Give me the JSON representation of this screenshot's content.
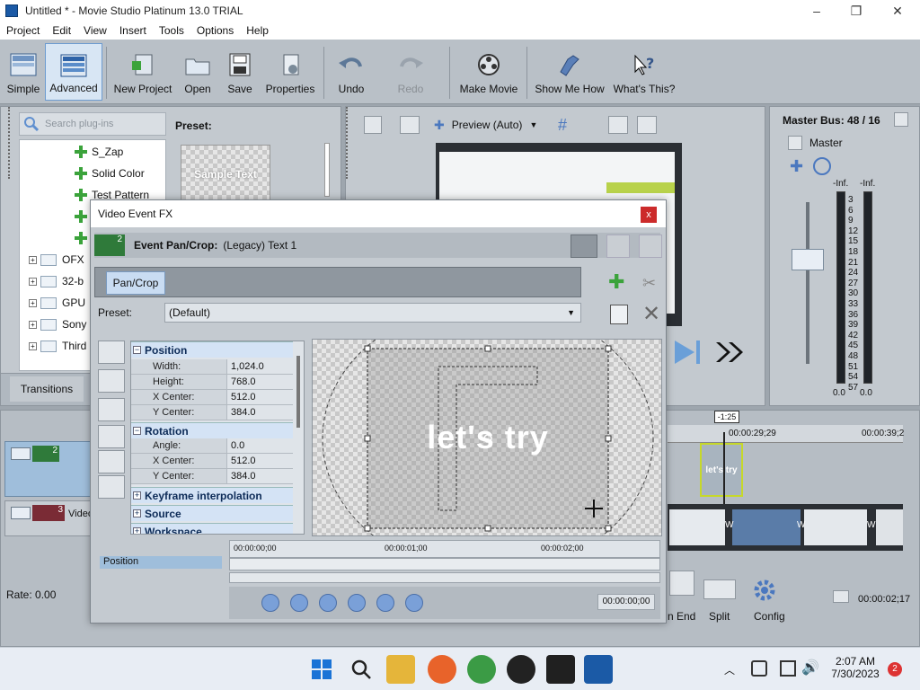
{
  "window": {
    "title": "Untitled * - Movie Studio Platinum 13.0 TRIAL",
    "minimize": "–",
    "maximize": "❐",
    "close": "✕"
  },
  "menu": [
    "Project",
    "Edit",
    "View",
    "Insert",
    "Tools",
    "Options",
    "Help"
  ],
  "toolbar": {
    "simple": "Simple",
    "advanced": "Advanced",
    "new_project": "New Project",
    "open": "Open",
    "save": "Save",
    "properties": "Properties",
    "undo": "Undo",
    "redo": "Redo",
    "make_movie": "Make Movie",
    "show_me_how": "Show Me How",
    "whats_this": "What's This?"
  },
  "plugins": {
    "search_placeholder": "Search plug-ins",
    "preset_label": "Preset:",
    "preset_thumb": "Sample Text",
    "items": [
      "S_Zap",
      "Solid Color",
      "Test Pattern"
    ],
    "folders": [
      "OFX",
      "32-b",
      "GPU",
      "Sony",
      "Third"
    ],
    "transitions_tab": "Transitions"
  },
  "preview": {
    "mode": "Preview (Auto)"
  },
  "master": {
    "label": "Master Bus: 48 / 16",
    "name": "Master",
    "left_inf": "-Inf.",
    "right_inf": "-Inf.",
    "scale": [
      "3",
      "6",
      "9",
      "12",
      "15",
      "18",
      "21",
      "24",
      "27",
      "30",
      "33",
      "36",
      "39",
      "42",
      "45",
      "48",
      "51",
      "54",
      "57"
    ],
    "left_val": "0.0",
    "right_val": "0.0"
  },
  "timeline": {
    "pos_badge": "-1:25",
    "time1": "00:00:29;29",
    "time2": "00:00:39;2",
    "clip_text": "let's try",
    "track2_num": "2",
    "track3_num": "3",
    "track3_name": "Video",
    "rate": "Rate: 0.00",
    "end_btn": "n End",
    "split_btn": "Split",
    "config_btn": "Config",
    "time_readout": "00:00:02;17",
    "w_marks": [
      "W",
      "W",
      "W"
    ]
  },
  "dialog": {
    "title": "Video Event FX",
    "close": "x",
    "badge": "2",
    "event_label": "Event Pan/Crop:",
    "event_value": "(Legacy) Text 1",
    "chain_item": "Pan/Crop",
    "preset_label": "Preset:",
    "preset_value": "(Default)",
    "groups": {
      "position": "Position",
      "rotation": "Rotation",
      "keyframe": "Keyframe interpolation",
      "source": "Source",
      "workspace": "Workspace"
    },
    "position_rows": [
      {
        "k": "Width:",
        "v": "1,024.0"
      },
      {
        "k": "Height:",
        "v": "768.0"
      },
      {
        "k": "X Center:",
        "v": "512.0"
      },
      {
        "k": "Y Center:",
        "v": "384.0"
      }
    ],
    "rotation_rows": [
      {
        "k": "Angle:",
        "v": "0.0"
      },
      {
        "k": "X Center:",
        "v": "512.0"
      },
      {
        "k": "Y Center:",
        "v": "384.0"
      }
    ],
    "canvas_text": "let's try",
    "kf_times": [
      "00:00:00;00",
      "00:00:01;00",
      "00:00:02;00"
    ],
    "position_track": "Position",
    "time_readout": "00:00:00;00"
  },
  "taskbar": {
    "time": "2:07 AM",
    "date": "7/30/2023",
    "notif": "2"
  },
  "colors": {
    "accent": "#3ba33b",
    "dialog_bg": "#c4cad0",
    "taskbar": "#e8edf4"
  }
}
